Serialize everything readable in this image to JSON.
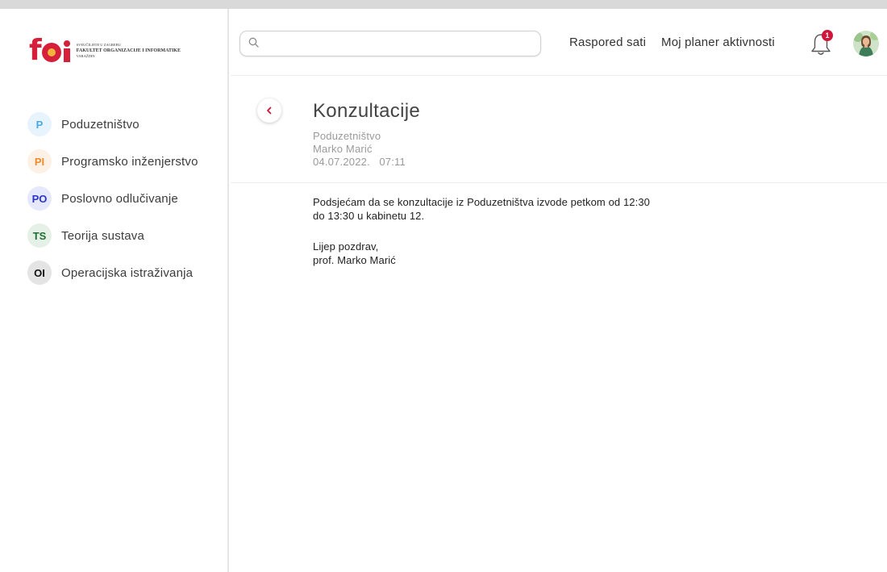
{
  "logo": {
    "word": "foi",
    "line1": "SVEUČILIŠTE U ZAGREBU",
    "line2": "FAKULTET ORGANIZACIJE I INFORMATIKE",
    "line3": "VARAŽDIN"
  },
  "sidebar": {
    "courses": [
      {
        "abbr": "P",
        "label": "Poduzetništvo",
        "badge_bg": "#e8f4fd",
        "badge_fg": "#4aa8e6"
      },
      {
        "abbr": "PI",
        "label": "Programsko inženjerstvo",
        "badge_bg": "#fdf0e4",
        "badge_fg": "#f08a2c"
      },
      {
        "abbr": "PO",
        "label": "Poslovno odlučivanje",
        "badge_bg": "#e6e8fb",
        "badge_fg": "#2c34c8"
      },
      {
        "abbr": "TS",
        "label": "Teorija sustava",
        "badge_bg": "#e5f1e7",
        "badge_fg": "#1f6e34"
      },
      {
        "abbr": "OI",
        "label": "Operacijska istraživanja",
        "badge_bg": "#e4e4e4",
        "badge_fg": "#111111"
      }
    ]
  },
  "header": {
    "search_placeholder": "",
    "links": {
      "schedule": "Raspored sati",
      "planner": "Moj planer aktivnosti"
    },
    "notification_count": "1",
    "bell_icon": "bell-icon",
    "avatar": "avatar"
  },
  "message": {
    "title": "Konzultacije",
    "course": "Poduzetništvo",
    "author": "Marko Marić",
    "date": "04.07.2022.",
    "time": "07:11",
    "body_line1": "Podsjećam da se konzultacije iz Poduzetništva izvode petkom od 12:30",
    "body_line2": "do 13:30 u kabinetu 12.",
    "closing1": "Lijep pozdrav,",
    "closing2": "prof. Marko Marić"
  },
  "colors": {
    "accent": "#d0163a",
    "logo_red": "#d61f3a",
    "logo_yellow": "#f2b33d"
  }
}
